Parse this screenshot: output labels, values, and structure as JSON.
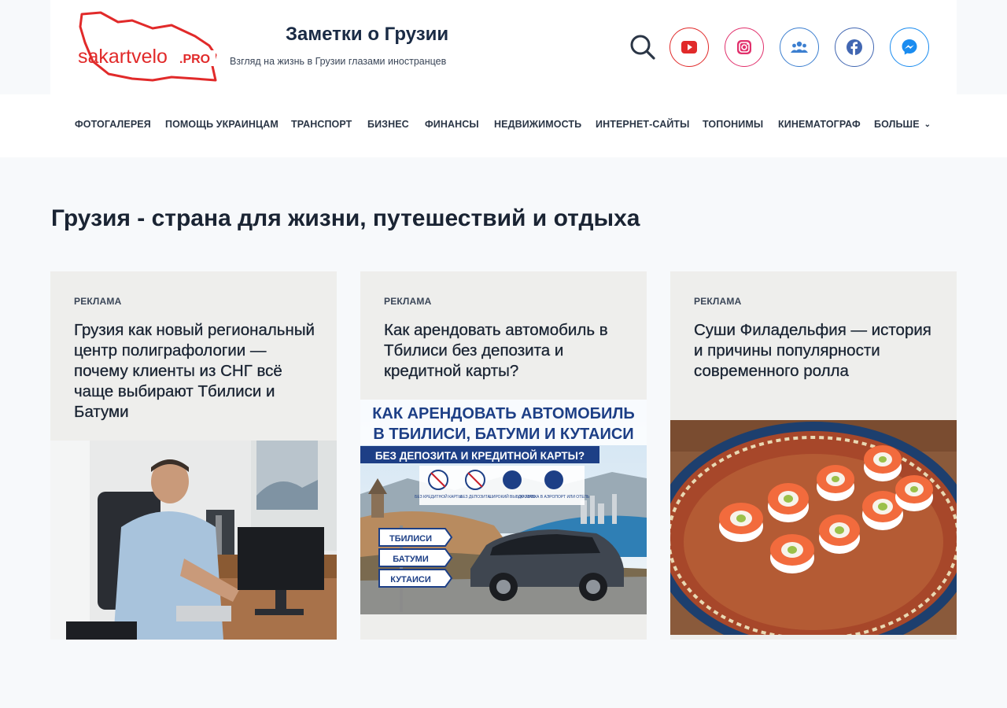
{
  "brand": {
    "logo_text": "sakartvelo",
    "logo_badge": ".PRO",
    "title": "Заметки о Грузии",
    "tagline": "Взгляд на жизнь в Грузии глазами иностранцев"
  },
  "header_icons": [
    "search-icon",
    "youtube-icon",
    "instagram-icon",
    "group-icon",
    "facebook-icon",
    "messenger-icon"
  ],
  "nav": {
    "items": [
      "ФОТОГАЛЕРЕЯ",
      "ПОМОЩЬ УКРАИНЦАМ",
      "ТРАНСПОРТ",
      "БИЗНЕС",
      "ФИНАНСЫ",
      "НЕДВИЖИМОСТЬ",
      "ИНТЕРНЕТ-САЙТЫ",
      "ТОПОНИМЫ",
      "КИНЕМАТОГРАФ"
    ],
    "more": "БОЛЬШЕ"
  },
  "page": {
    "title": "Грузия - страна для жизни, путешествий и отдыха"
  },
  "cards": [
    {
      "category": "РЕКЛАМА",
      "title": "Грузия как новый региональный центр полиграфологии — почему клиенты из СНГ всё чаще выбирают Тбилиси и Батуми"
    },
    {
      "category": "РЕКЛАМА",
      "title": "Как арендовать автомобиль в Тбилиси без депозита и кредитной карты?",
      "banner": {
        "line1": "КАК АРЕНДОВАТЬ АВТОМОБИЛЬ",
        "line2": "В ТБИЛИСИ, БАТУМИ И КУТАИСИ",
        "line3": "БЕЗ ДЕПОЗИТА И КРЕДИТНОЙ КАРТЫ?",
        "features": [
          "БЕЗ КРЕДИТНОЙ КАРТЫ",
          "БЕЗ ДЕПОЗИТА",
          "ШИРОКИЙ ВЫБОР АВТО",
          "ДОСТАВКА В АЭРОПОРТ ИЛИ ОТЕЛЬ"
        ],
        "signs": [
          "ТБИЛИСИ",
          "БАТУМИ",
          "КУТАИСИ"
        ]
      }
    },
    {
      "category": "РЕКЛАМА",
      "title": "Суши Филадельфия — история и причины популярности современного ролла"
    }
  ],
  "colors": {
    "accent_red": "#e12a2a",
    "text_dark": "#1a2433",
    "card_bg": "#eeeeec",
    "page_bg": "#f7f9fb"
  }
}
